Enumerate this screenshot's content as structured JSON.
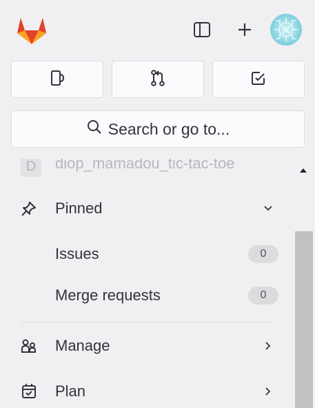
{
  "app": {
    "logo": "gitlab-tanuki-logo"
  },
  "topbar": {
    "sidebar_toggle_icon": "sidebar-toggle-icon",
    "create_icon": "plus-icon",
    "avatar_icon": "user-avatar"
  },
  "quick_actions": [
    {
      "name": "issues",
      "icon": "issue-icon"
    },
    {
      "name": "merge-requests",
      "icon": "merge-request-icon"
    },
    {
      "name": "todos",
      "icon": "todo-checkbox-icon"
    }
  ],
  "search": {
    "label": "Search or go to..."
  },
  "project": {
    "avatar_letter": "D",
    "name": "diop_mamadou_tic-tac-toe"
  },
  "nav": {
    "pinned": {
      "label": "Pinned",
      "icon": "pin-icon",
      "expanded": true
    },
    "issues": {
      "label": "Issues",
      "count": "0"
    },
    "merge_requests": {
      "label": "Merge requests",
      "count": "0"
    },
    "manage": {
      "label": "Manage",
      "icon": "users-icon"
    },
    "plan": {
      "label": "Plan",
      "icon": "calendar-icon"
    }
  },
  "colors": {
    "accent_orange": "#fc6d26",
    "dark_orange": "#e24329",
    "light_orange": "#fca326"
  }
}
